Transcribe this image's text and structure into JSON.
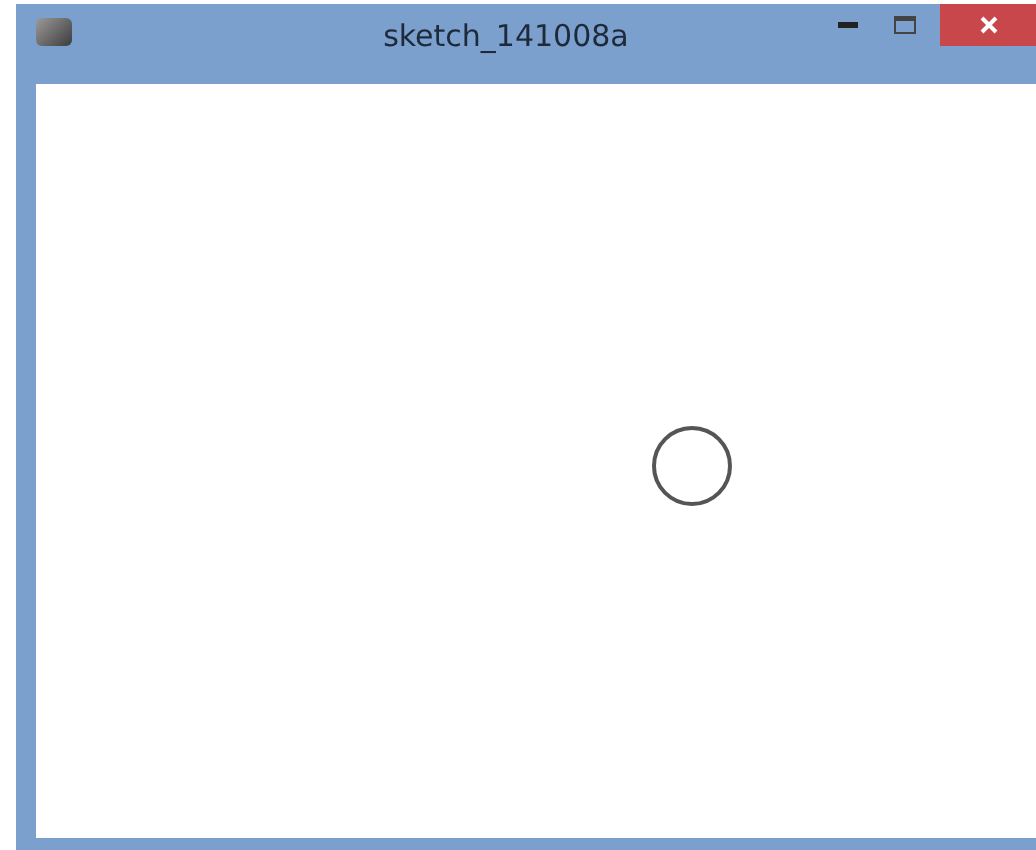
{
  "window": {
    "title": "sketch_141008a"
  }
}
